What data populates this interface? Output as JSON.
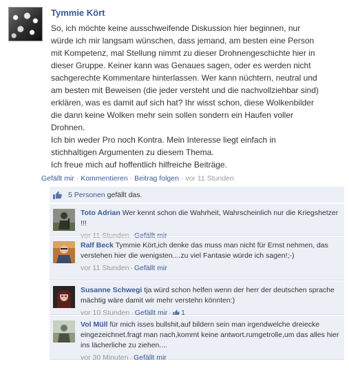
{
  "post": {
    "author": "Tymmie Kört",
    "text": "So, ich möchte keine ausschweifende Diskussion hier beginnen, nur\nwürde ich mir langsam wünschen, dass jemand, am besten eine Person\nmit Kompetenz, mal Stellung nimmt zu dieser Drohnengeschichte hier in\ndieser Gruppe. Keiner kann was Genaues sagen, oder es werden nicht\nsachgerechte Kommentare hinterlassen. Wer kann nüchtern, neutral und\nam besten mit Beweisen (die jeder versteht und die nachvollziehbar sind)\nerklären, was es damit auf sich hat? Ihr wisst schon, diese Wolkenbilder\ndie dann keine Wolken mehr sein sollen sondern ein Haufen voller\nDrohnen.\nIch bin weder Pro noch Kontra. Mein Interesse liegt einfach in\nstichhaltigen Argumenten zu diesem Thema.\nIch freue mich auf hoffentlich hilfreiche Beiträge.",
    "actions": {
      "like": "Gefällt mir",
      "comment": "Kommentieren",
      "follow": "Beitrag folgen",
      "time": "vor 11 Stunden"
    },
    "likes": {
      "count_link": "5 Personen",
      "suffix": "gefällt das."
    }
  },
  "comments": [
    {
      "author": "Toto Adrian",
      "text": "Wer kennt schon die Wahrheit, Wahrscheinlich nur die Kriegshetzer !!!",
      "time": "vor 11 Stunden",
      "like": "Gefällt mir",
      "avatar_icon": "soldier-avatar"
    },
    {
      "author": "Ralf Beck",
      "text": "Tymmie Kört,ich denke das muss man nicht für Ernst nehmen, das verstehen hier die wenigsten....zu viel Fantasie würde ich sagen!;-)",
      "time": "vor 11 Stunden",
      "like": "Gefällt mir",
      "avatar_icon": "person-avatar"
    },
    {
      "author": "Susanne Schwegi",
      "text": "tja würd schon helfen wenn der herr der deutschen sprache mächtig wäre damit wir mehr verstehn könnten:)",
      "time": "vor 10 Stunden",
      "like": "Gefällt mir",
      "like_count": "1",
      "avatar_icon": "woman-avatar"
    },
    {
      "author": "Vol Müll",
      "text": "für mich isses bullshit,auf bildern sein man irgendwelche dreiecke eingezeichnet.fragt man nach,kommt keine antwort.rumgetrolle,um das alles hier ins lächerliche zu ziehen....",
      "time": "vor 30 Minuten",
      "like": "Gefällt mir",
      "avatar_icon": "person-avatar"
    }
  ],
  "colors": {
    "link": "#3b5998",
    "meta": "#999999",
    "feedback_bg": "#eceff5"
  }
}
